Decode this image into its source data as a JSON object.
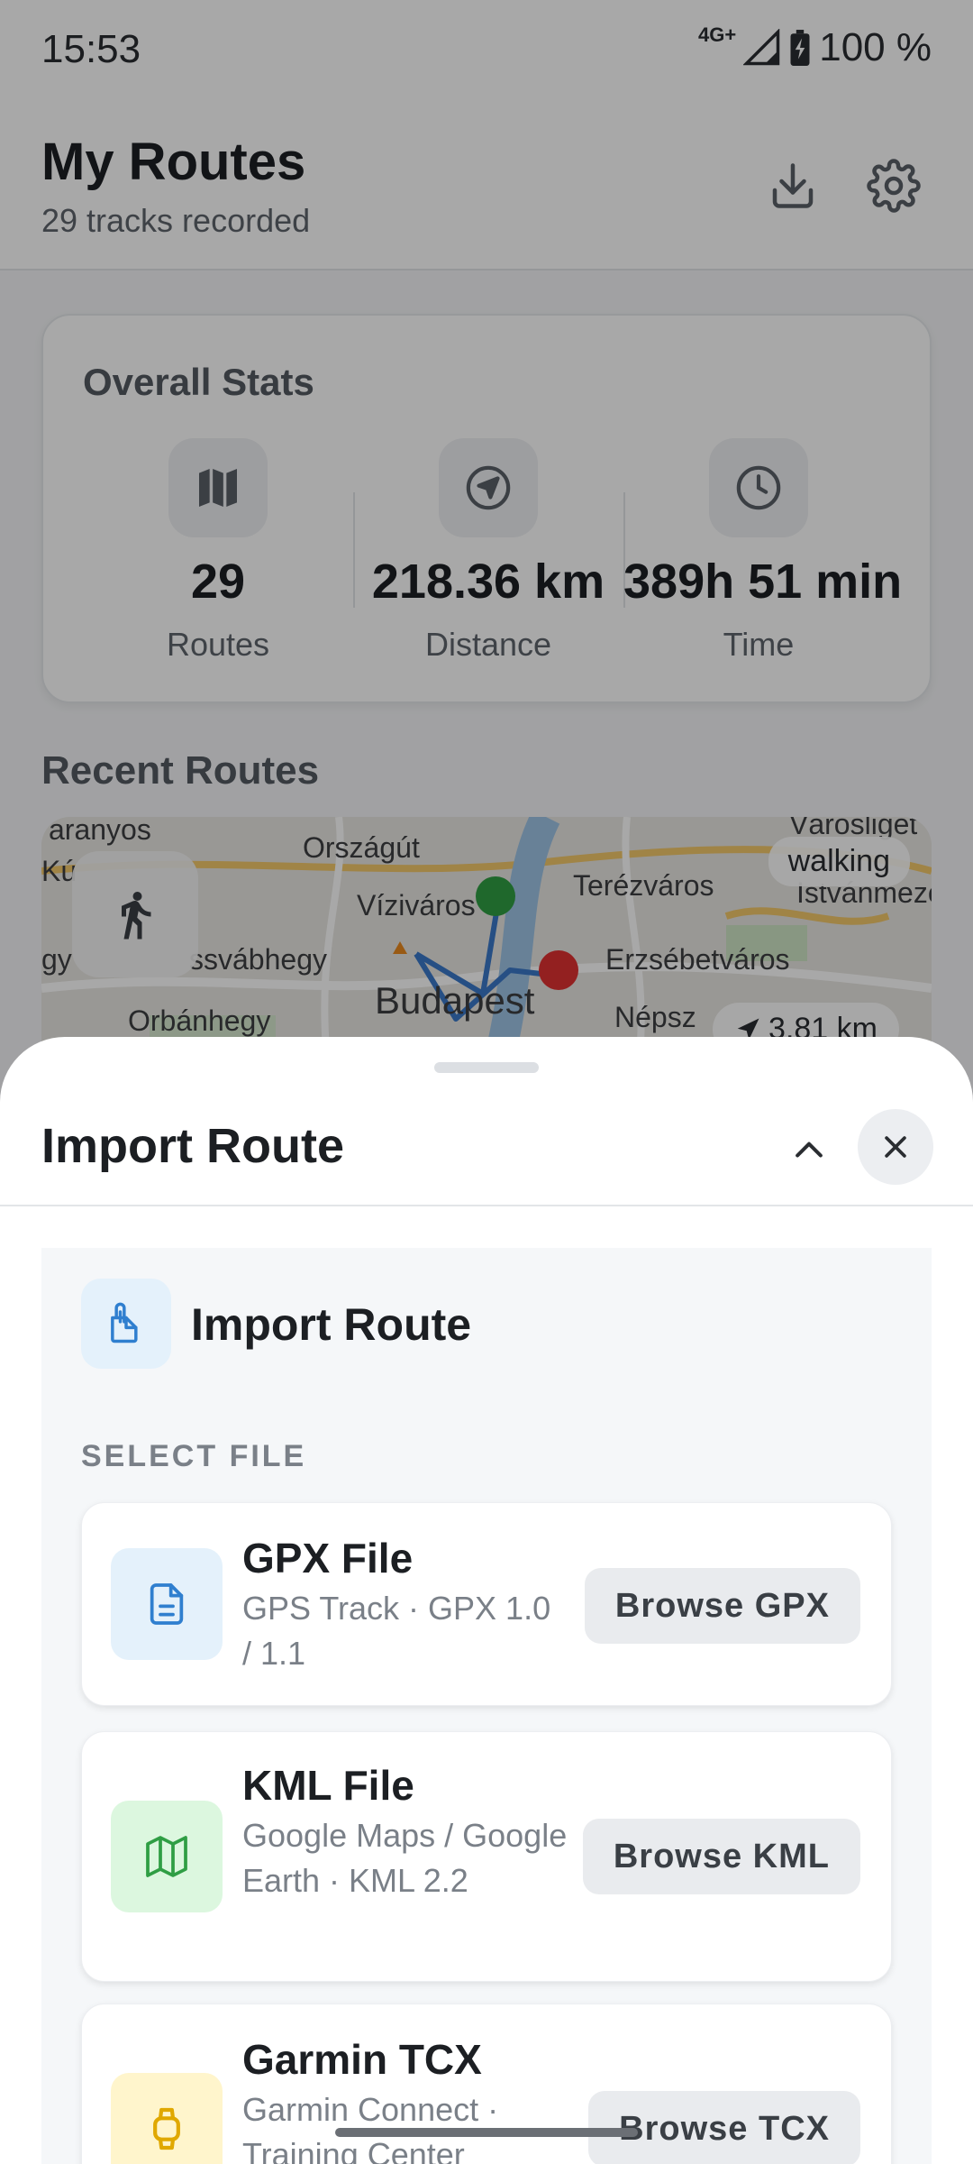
{
  "status": {
    "time": "15:53",
    "network": "4G+",
    "battery": "100 %"
  },
  "header": {
    "title": "My Routes",
    "subtitle": "29 tracks recorded",
    "import_icon": "download-icon",
    "settings_icon": "gear-icon"
  },
  "stats": {
    "title": "Overall Stats",
    "items": [
      {
        "value": "29",
        "label": "Routes",
        "icon": "map-icon"
      },
      {
        "value": "218.36 km",
        "label": "Distance",
        "icon": "navigation-icon"
      },
      {
        "value": "389h 51 min",
        "label": "Time",
        "icon": "clock-icon"
      }
    ]
  },
  "recent": {
    "title": "Recent Routes",
    "route": {
      "activity": "walking",
      "distance": "3.81 km",
      "map_labels": [
        "Víziváros",
        "Terézváros",
        "Erzsébetváros",
        "Budapest",
        "Orbánhegy",
        "Országút",
        "Istvánmező",
        "Népsz",
        "ssvábhegy",
        "Kú",
        "aranyos",
        "gy",
        "Városliget"
      ]
    }
  },
  "sheet": {
    "title": "Import Route",
    "panel_title": "Import Route",
    "section_label": "SELECT FILE",
    "files": [
      {
        "name": "GPX File",
        "desc": "GPS Track · GPX 1.0 / 1.1",
        "button": "Browse GPX",
        "icon": "document-icon",
        "icon_bg": "#e4f1fb",
        "icon_color": "#2f7fcf"
      },
      {
        "name": "KML File",
        "desc": "Google Maps / Google Earth · KML 2.2",
        "button": "Browse KML",
        "icon": "map-icon",
        "icon_bg": "#dcf7df",
        "icon_color": "#2f9e44"
      },
      {
        "name": "Garmin TCX",
        "desc": "Garmin Connect · Training Center",
        "button": "Browse TCX",
        "icon": "watch-icon",
        "icon_bg": "#fff5cc",
        "icon_color": "#e0a800"
      }
    ]
  },
  "colors": {
    "accent": "#2f7fcf",
    "route_line": "#3a78c9",
    "start_marker": "#2f9e44",
    "end_marker": "#e03131"
  }
}
